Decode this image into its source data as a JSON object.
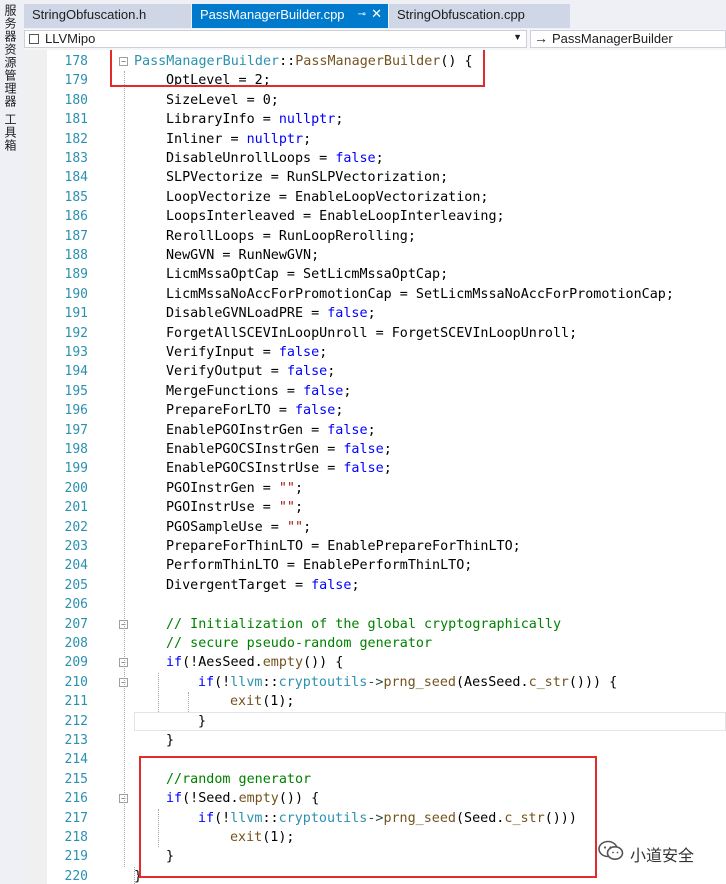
{
  "side_panel": {
    "label": "服务器资源管理器  工具箱"
  },
  "tabs": [
    {
      "label": "StringObfuscation.h",
      "active": false
    },
    {
      "label": "PassManagerBuilder.cpp",
      "active": true,
      "pin": "⊸",
      "close": "✕"
    },
    {
      "label": "StringObfuscation.cpp",
      "active": false
    }
  ],
  "nav": {
    "scope": "LLVMipo",
    "member_arrow": "→",
    "member": "PassManagerBuilder"
  },
  "colors": {
    "accent": "#007acc",
    "keyword": "#0000ff",
    "function": "#74531f",
    "type": "#2b91af",
    "comment": "#008000",
    "string": "#a31515",
    "highlight_box": "#e32b2b"
  },
  "editor": {
    "lines": [
      {
        "n": "178",
        "indent": 0,
        "fold": "−",
        "tokens": [
          [
            "ty",
            "PassManagerBuilder"
          ],
          [
            "",
            "::"
          ],
          [
            "fn",
            "PassManagerBuilder"
          ],
          [
            "",
            "() {"
          ]
        ]
      },
      {
        "n": "179",
        "indent": 1,
        "tokens": [
          [
            "",
            "OptLevel = 2;"
          ]
        ]
      },
      {
        "n": "180",
        "indent": 1,
        "tokens": [
          [
            "",
            "SizeLevel = 0;"
          ]
        ]
      },
      {
        "n": "181",
        "indent": 1,
        "tokens": [
          [
            "",
            "LibraryInfo = "
          ],
          [
            "kw",
            "nullptr"
          ],
          [
            "",
            ";"
          ]
        ]
      },
      {
        "n": "182",
        "indent": 1,
        "tokens": [
          [
            "",
            "Inliner = "
          ],
          [
            "kw",
            "nullptr"
          ],
          [
            "",
            ";"
          ]
        ]
      },
      {
        "n": "183",
        "indent": 1,
        "tokens": [
          [
            "",
            "DisableUnrollLoops = "
          ],
          [
            "kw",
            "false"
          ],
          [
            "",
            ";"
          ]
        ]
      },
      {
        "n": "184",
        "indent": 1,
        "tokens": [
          [
            "",
            "SLPVectorize = RunSLPVectorization;"
          ]
        ]
      },
      {
        "n": "185",
        "indent": 1,
        "tokens": [
          [
            "",
            "LoopVectorize = EnableLoopVectorization;"
          ]
        ]
      },
      {
        "n": "186",
        "indent": 1,
        "tokens": [
          [
            "",
            "LoopsInterleaved = EnableLoopInterleaving;"
          ]
        ]
      },
      {
        "n": "187",
        "indent": 1,
        "tokens": [
          [
            "",
            "RerollLoops = RunLoopRerolling;"
          ]
        ]
      },
      {
        "n": "188",
        "indent": 1,
        "tokens": [
          [
            "",
            "NewGVN = RunNewGVN;"
          ]
        ]
      },
      {
        "n": "189",
        "indent": 1,
        "tokens": [
          [
            "",
            "LicmMssaOptCap = SetLicmMssaOptCap;"
          ]
        ]
      },
      {
        "n": "190",
        "indent": 1,
        "tokens": [
          [
            "",
            "LicmMssaNoAccForPromotionCap = SetLicmMssaNoAccForPromotionCap;"
          ]
        ]
      },
      {
        "n": "191",
        "indent": 1,
        "tokens": [
          [
            "",
            "DisableGVNLoadPRE = "
          ],
          [
            "kw",
            "false"
          ],
          [
            "",
            ";"
          ]
        ]
      },
      {
        "n": "192",
        "indent": 1,
        "tokens": [
          [
            "",
            "ForgetAllSCEVInLoopUnroll = ForgetSCEVInLoopUnroll;"
          ]
        ]
      },
      {
        "n": "193",
        "indent": 1,
        "tokens": [
          [
            "",
            "VerifyInput = "
          ],
          [
            "kw",
            "false"
          ],
          [
            "",
            ";"
          ]
        ]
      },
      {
        "n": "194",
        "indent": 1,
        "tokens": [
          [
            "",
            "VerifyOutput = "
          ],
          [
            "kw",
            "false"
          ],
          [
            "",
            ";"
          ]
        ]
      },
      {
        "n": "195",
        "indent": 1,
        "tokens": [
          [
            "",
            "MergeFunctions = "
          ],
          [
            "kw",
            "false"
          ],
          [
            "",
            ";"
          ]
        ]
      },
      {
        "n": "196",
        "indent": 1,
        "tokens": [
          [
            "",
            "PrepareForLTO = "
          ],
          [
            "kw",
            "false"
          ],
          [
            "",
            ";"
          ]
        ]
      },
      {
        "n": "197",
        "indent": 1,
        "tokens": [
          [
            "",
            "EnablePGOInstrGen = "
          ],
          [
            "kw",
            "false"
          ],
          [
            "",
            ";"
          ]
        ]
      },
      {
        "n": "198",
        "indent": 1,
        "tokens": [
          [
            "",
            "EnablePGOCSInstrGen = "
          ],
          [
            "kw",
            "false"
          ],
          [
            "",
            ";"
          ]
        ]
      },
      {
        "n": "199",
        "indent": 1,
        "tokens": [
          [
            "",
            "EnablePGOCSInstrUse = "
          ],
          [
            "kw",
            "false"
          ],
          [
            "",
            ";"
          ]
        ]
      },
      {
        "n": "200",
        "indent": 1,
        "tokens": [
          [
            "",
            "PGOInstrGen = "
          ],
          [
            "st",
            "\"\""
          ],
          [
            "",
            ";"
          ]
        ]
      },
      {
        "n": "201",
        "indent": 1,
        "tokens": [
          [
            "",
            "PGOInstrUse = "
          ],
          [
            "st",
            "\"\""
          ],
          [
            "",
            ";"
          ]
        ]
      },
      {
        "n": "202",
        "indent": 1,
        "tokens": [
          [
            "",
            "PGOSampleUse = "
          ],
          [
            "st",
            "\"\""
          ],
          [
            "",
            ";"
          ]
        ]
      },
      {
        "n": "203",
        "indent": 1,
        "tokens": [
          [
            "",
            "PrepareForThinLTO = EnablePrepareForThinLTO;"
          ]
        ]
      },
      {
        "n": "204",
        "indent": 1,
        "tokens": [
          [
            "",
            "PerformThinLTO = EnablePerformThinLTO;"
          ]
        ]
      },
      {
        "n": "205",
        "indent": 1,
        "tokens": [
          [
            "",
            "DivergentTarget = "
          ],
          [
            "kw",
            "false"
          ],
          [
            "",
            ";"
          ]
        ]
      },
      {
        "n": "206",
        "indent": 0,
        "tokens": []
      },
      {
        "n": "207",
        "indent": 1,
        "fold": "−",
        "tokens": [
          [
            "cm",
            "// Initialization of the global cryptographically"
          ]
        ]
      },
      {
        "n": "208",
        "indent": 1,
        "tokens": [
          [
            "cm",
            "// secure pseudo-random generator"
          ]
        ]
      },
      {
        "n": "209",
        "indent": 1,
        "fold": "−",
        "tokens": [
          [
            "kw",
            "if"
          ],
          [
            "",
            "(!AesSeed."
          ],
          [
            "fn",
            "empty"
          ],
          [
            "",
            "()) {"
          ]
        ]
      },
      {
        "n": "210",
        "indent": 2,
        "fold": "−",
        "tokens": [
          [
            "kw",
            "if"
          ],
          [
            "",
            "(!"
          ],
          [
            "ty",
            "llvm"
          ],
          [
            "",
            "::"
          ],
          [
            "ty",
            "cryptoutils"
          ],
          [
            "mv",
            "->"
          ],
          [
            "fn",
            "prng_seed"
          ],
          [
            "",
            "(AesSeed."
          ],
          [
            "fn",
            "c_str"
          ],
          [
            "",
            "())) {"
          ]
        ]
      },
      {
        "n": "211",
        "indent": 3,
        "tokens": [
          [
            "fn",
            "exit"
          ],
          [
            "",
            "(1);"
          ]
        ]
      },
      {
        "n": "212",
        "indent": 2,
        "tokens": [
          [
            "",
            "}"
          ]
        ]
      },
      {
        "n": "213",
        "indent": 1,
        "tokens": [
          [
            "",
            "}"
          ]
        ]
      },
      {
        "n": "214",
        "indent": 0,
        "tokens": []
      },
      {
        "n": "215",
        "indent": 1,
        "tokens": [
          [
            "cm",
            "//random generator"
          ]
        ]
      },
      {
        "n": "216",
        "indent": 1,
        "fold": "−",
        "tokens": [
          [
            "kw",
            "if"
          ],
          [
            "",
            "(!Seed."
          ],
          [
            "fn",
            "empty"
          ],
          [
            "",
            "()) {"
          ]
        ]
      },
      {
        "n": "217",
        "indent": 2,
        "tokens": [
          [
            "kw",
            "if"
          ],
          [
            "",
            "(!"
          ],
          [
            "ty",
            "llvm"
          ],
          [
            "",
            "::"
          ],
          [
            "ty",
            "cryptoutils"
          ],
          [
            "mv",
            "->"
          ],
          [
            "fn",
            "prng_seed"
          ],
          [
            "",
            "(Seed."
          ],
          [
            "fn",
            "c_str"
          ],
          [
            "",
            "()))"
          ]
        ]
      },
      {
        "n": "218",
        "indent": 3,
        "tokens": [
          [
            "fn",
            "exit"
          ],
          [
            "",
            "(1);"
          ]
        ]
      },
      {
        "n": "219",
        "indent": 1,
        "tokens": [
          [
            "",
            "}"
          ]
        ]
      },
      {
        "n": "220",
        "indent": 0,
        "tokens": [
          [
            "",
            "}"
          ]
        ]
      }
    ]
  },
  "watermark": {
    "icon": "wechat-icon",
    "text": "小道安全"
  }
}
